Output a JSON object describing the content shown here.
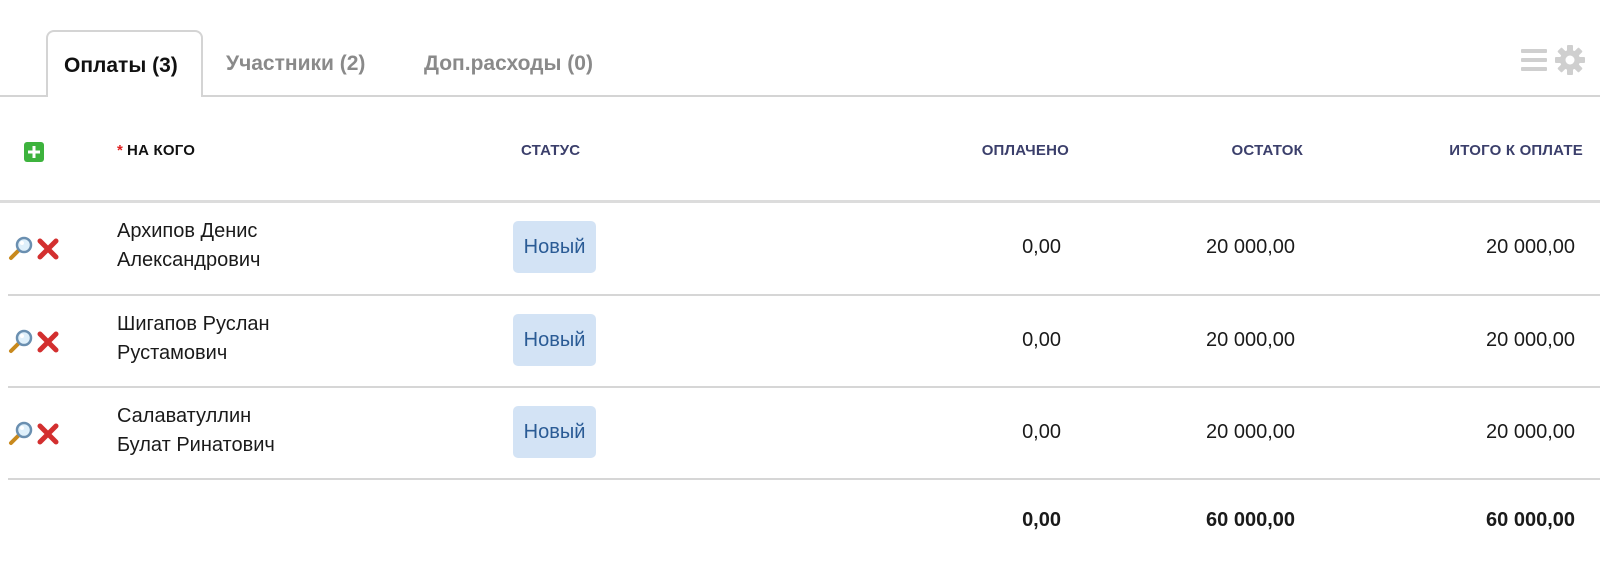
{
  "tabs": [
    {
      "label": "Оплаты (3)",
      "active": true
    },
    {
      "label": "Участники  (2)",
      "active": false
    },
    {
      "label": "Доп.расходы (0)",
      "active": false
    }
  ],
  "toolbar": {
    "icons": [
      "list-icon",
      "gear-icon"
    ]
  },
  "table": {
    "columns": {
      "required_mark": "*",
      "who": "НА КОГО",
      "status": "СТАТУС",
      "paid": "ОПЛАЧЕНО",
      "rest": "ОСТАТОК",
      "total": "ИТОГО К ОПЛАТЕ"
    },
    "rows": [
      {
        "name_line1": "Архипов Денис",
        "name_line2": "Александрович",
        "status": "Новый",
        "paid": "0,00",
        "rest": "20 000,00",
        "total": "20 000,00"
      },
      {
        "name_line1": "Шигапов Руслан",
        "name_line2": "Рустамович",
        "status": "Новый",
        "paid": "0,00",
        "rest": "20 000,00",
        "total": "20 000,00"
      },
      {
        "name_line1": "Салаватуллин",
        "name_line2": "Булат Ринатович",
        "status": "Новый",
        "paid": "0,00",
        "rest": "20 000,00",
        "total": "20 000,00"
      }
    ],
    "totals": {
      "paid": "0,00",
      "rest": "60 000,00",
      "total": "60 000,00"
    }
  },
  "colors": {
    "status_badge_bg": "#d3e3f5",
    "status_badge_text": "#2a5b95",
    "header_text": "#3b3f6b",
    "required": "#e02020",
    "add_button": "#3db33d",
    "delete_icon": "#d32f2f"
  }
}
